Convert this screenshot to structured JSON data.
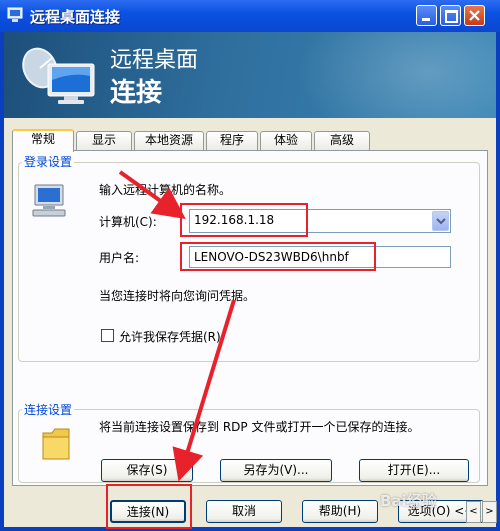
{
  "window": {
    "title": "远程桌面连接"
  },
  "banner": {
    "title_line1": "远程桌面",
    "title_line2": "连接"
  },
  "tabs": [
    {
      "label": "常规",
      "active": true
    },
    {
      "label": "显示"
    },
    {
      "label": "本地资源"
    },
    {
      "label": "程序"
    },
    {
      "label": "体验"
    },
    {
      "label": "高级"
    }
  ],
  "login": {
    "group_label": "登录设置",
    "instruction": "输入远程计算机的名称。",
    "computer_label": "计算机(C):",
    "computer_value": "192.168.1.18",
    "username_label": "用户名:",
    "username_value": "LENOVO-DS23WBD6\\hnbf",
    "prompt_text": "当您连接时将向您询问凭据。",
    "save_credentials_label": "允许我保存凭据(R)",
    "save_credentials_checked": false
  },
  "connection": {
    "group_label": "连接设置",
    "description": "将当前连接设置保存到 RDP 文件或打开一个已保存的连接。",
    "save_label": "保存(S)",
    "save_as_label": "另存为(V)...",
    "open_label": "打开(E)..."
  },
  "footer": {
    "connect_label": "连接(N)",
    "cancel_label": "取消",
    "help_label": "帮助(H)",
    "options_label": "选项(O) <<"
  },
  "watermark": "Bai经验",
  "colors": {
    "highlight": "#e8222a",
    "group_label": "#0046d5",
    "titlebar": "#0b52e3"
  }
}
